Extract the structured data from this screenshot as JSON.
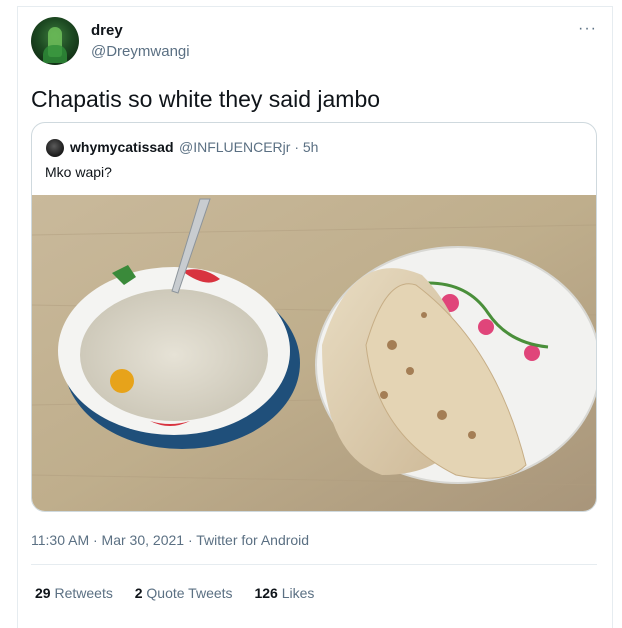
{
  "author": {
    "name": "drey",
    "handle": "@Dreymwangi",
    "avatar_icon": "profile-avatar-icon"
  },
  "more_icon": "more-options-icon",
  "tweet": {
    "text": "Chapatis so white they said jambo"
  },
  "quoted_tweet": {
    "name": "whymycatissad",
    "handle_time": "@INFLUENCERjr · 5h",
    "text": "Mko wapi?",
    "photo_description_icon": "photo"
  },
  "meta": {
    "time": "11:30 AM · Mar 30, 2021 · ",
    "app": "Twitter for Android"
  },
  "stats": {
    "retweets_count": "29",
    "retweets_label": "Retweets",
    "quotes_count": "2",
    "quotes_label": "Quote Tweets",
    "likes_count": "126",
    "likes_label": "Likes"
  },
  "colors": {
    "text": "#0f1419",
    "secondary": "#5b7083",
    "border": "#cfd9de"
  }
}
